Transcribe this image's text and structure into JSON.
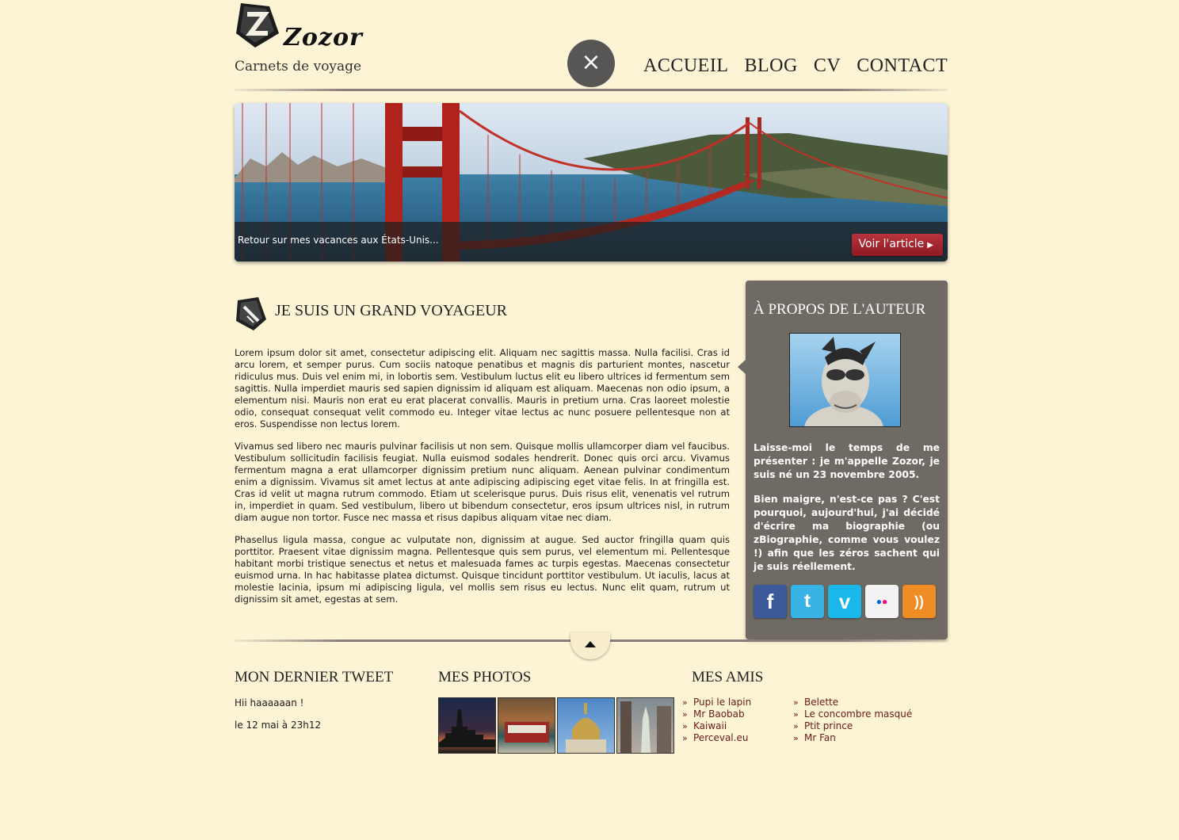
{
  "brand": {
    "name": "Zozor",
    "tagline": "Carnets de voyage"
  },
  "nav": {
    "close_icon": "×",
    "items": [
      "ACCUEIL",
      "BLOG",
      "CV",
      "CONTACT"
    ]
  },
  "banner": {
    "caption": "Retour sur mes vacances aux États-Unis...",
    "button": "Voir l'article"
  },
  "article": {
    "title": "JE SUIS UN GRAND VOYAGEUR",
    "paragraphs": [
      "Lorem ipsum dolor sit amet, consectetur adipiscing elit. Aliquam nec sagittis massa. Nulla facilisi. Cras id arcu lorem, et semper purus. Cum sociis natoque penatibus et magnis dis parturient montes, nascetur ridiculus mus. Duis vel enim mi, in lobortis sem. Vestibulum luctus elit eu libero ultrices id fermentum sem sagittis. Nulla imperdiet mauris sed sapien dignissim id aliquam est aliquam. Maecenas non odio ipsum, a elementum nisi. Mauris non erat eu erat placerat convallis. Mauris in pretium urna. Cras laoreet molestie odio, consequat consequat velit commodo eu. Integer vitae lectus ac nunc posuere pellentesque non at eros. Suspendisse non lectus lorem.",
      "Vivamus sed libero nec mauris pulvinar facilisis ut non sem. Quisque mollis ullamcorper diam vel faucibus. Vestibulum sollicitudin facilisis feugiat. Nulla euismod sodales hendrerit. Donec quis orci arcu. Vivamus fermentum magna a erat ullamcorper dignissim pretium nunc aliquam. Aenean pulvinar condimentum enim a dignissim. Vivamus sit amet lectus at ante adipiscing adipiscing eget vitae felis. In at fringilla est. Cras id velit ut magna rutrum commodo. Etiam ut scelerisque purus. Duis risus elit, venenatis vel rutrum in, imperdiet in quam. Sed vestibulum, libero ut bibendum consectetur, eros ipsum ultrices nisl, in rutrum diam augue non tortor. Fusce nec massa et risus dapibus aliquam vitae nec diam.",
      "Phasellus ligula massa, congue ac vulputate non, dignissim at augue. Sed auctor fringilla quam quis porttitor. Praesent vitae dignissim magna. Pellentesque quis sem purus, vel elementum mi. Pellentesque habitant morbi tristique senectus et netus et malesuada fames ac turpis egestas. Maecenas consectetur euismod urna. In hac habitasse platea dictumst. Quisque tincidunt porttitor vestibulum. Ut iaculis, lacus at molestie lacinia, ipsum mi adipiscing ligula, vel mollis sem risus eu lectus. Nunc elit quam, rutrum ut dignissim sit amet, egestas at sem."
    ]
  },
  "aside": {
    "title": "À PROPOS DE L'AUTEUR",
    "paragraphs": [
      "Laisse-moi le temps de me présenter : je m'appelle Zozor, je suis né un 23 novembre 2005.",
      "Bien maigre, n'est-ce pas ? C'est pourquoi, aujourd'hui, j'ai décidé d'écrire ma biographie (ou zBiographie, comme vous voulez !) afin que les zéros sachent qui je suis réellement."
    ],
    "socials": [
      {
        "name": "facebook-icon",
        "glyph": "f",
        "color": "#3b5998"
      },
      {
        "name": "twitter-icon",
        "glyph": "t",
        "color": "#38b3e6"
      },
      {
        "name": "vimeo-icon",
        "glyph": "v",
        "color": "#1ab7ea"
      },
      {
        "name": "flickr-icon",
        "glyph": "●●",
        "color": "#f3f3f3"
      },
      {
        "name": "rss-icon",
        "glyph": "))",
        "color": "#f08c24"
      }
    ]
  },
  "footer": {
    "tweet": {
      "title": "MON DERNIER TWEET",
      "text": "Hii haaaaaan !",
      "date": "le 12 mai à 23h12"
    },
    "photos": {
      "title": "MES PHOTOS",
      "items": [
        "new-york-skyline-photo",
        "cable-car-photo",
        "invalides-dome-photo",
        "las-vegas-liberty-photo"
      ]
    },
    "friends": {
      "title": "MES AMIS",
      "col1": [
        "Pupi le lapin",
        "Mr Baobab",
        "Kaiwaii",
        "Perceval.eu"
      ],
      "col2": [
        "Belette",
        "Le concombre masqué",
        "Ptit prince",
        "Mr Fan"
      ]
    }
  }
}
